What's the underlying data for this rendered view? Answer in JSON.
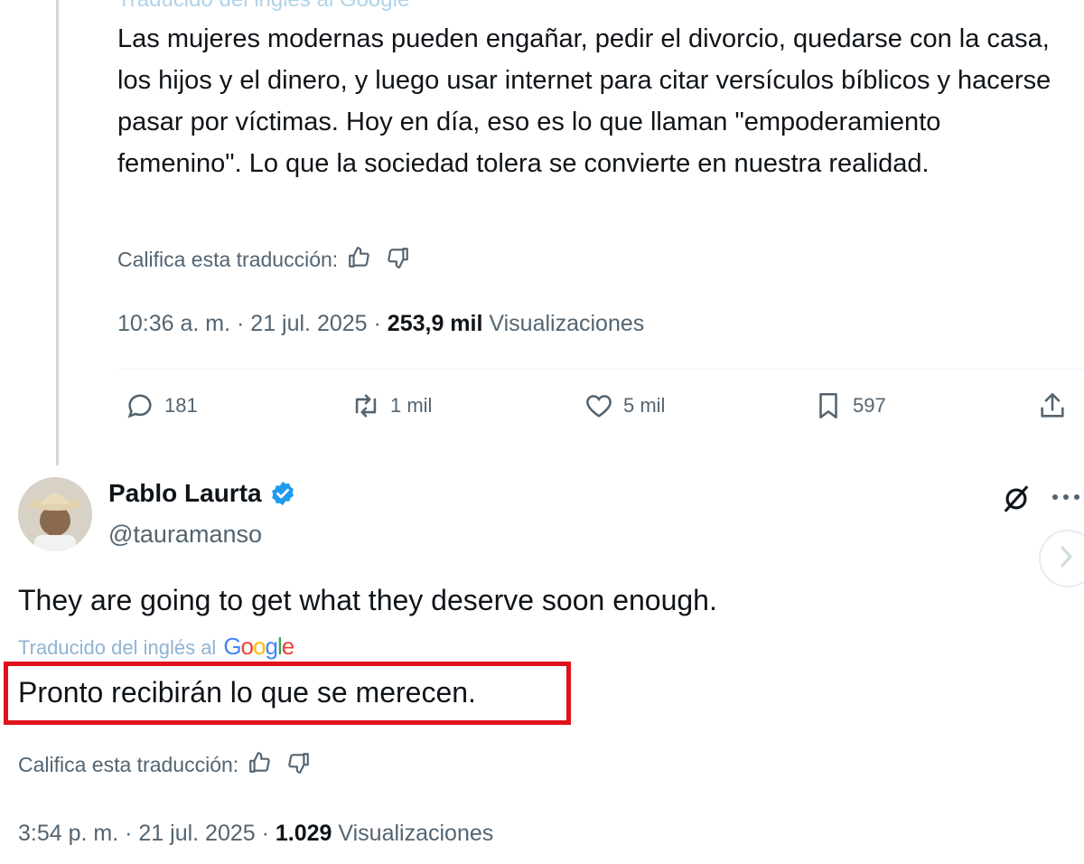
{
  "quoted_post": {
    "cutoff_header": "Traducido del inglés al Google",
    "text": "Las mujeres modernas pueden engañar, pedir el divorcio, quedarse con la casa, los hijos y el dinero, y luego usar internet para citar versículos bíblicos y hacerse pasar por víctimas. Hoy en día, eso es lo que llaman \"empoderamiento femenino\". Lo que la sociedad tolera se convierte en nuestra realidad.",
    "rate_label": "Califica esta traducción:",
    "timestamp": "10:36 a. m. · 21 jul. 2025 ·",
    "views_count": "253,9 mil",
    "views_label": "Visualizaciones",
    "actions": {
      "replies": "181",
      "reposts": "1 mil",
      "likes": "5 mil",
      "bookmarks": "597"
    }
  },
  "reply_post": {
    "author_name": "Pablo Laurta",
    "handle": "@tauramanso",
    "text": "They are going to get what they deserve soon enough.",
    "translated_from": "Traducido del inglés al",
    "translator": "Google",
    "translation": "Pronto recibirán lo que se merecen.",
    "rate_label": "Califica esta traducción:",
    "timestamp": "3:54 p. m. · 21 jul. 2025 ·",
    "views_count": "1.029",
    "views_label": "Visualizaciones"
  },
  "colors": {
    "text": "#0f1419",
    "secondary": "#536471",
    "verified": "#1d9bf0",
    "highlight": "#e0121b",
    "link": "#8fb3d4"
  },
  "icons": [
    "thumbs-up-icon",
    "thumbs-down-icon",
    "reply-icon",
    "repost-icon",
    "like-icon",
    "bookmark-icon",
    "share-icon",
    "verified-icon",
    "grok-icon",
    "more-icon",
    "chevron-right-icon"
  ]
}
